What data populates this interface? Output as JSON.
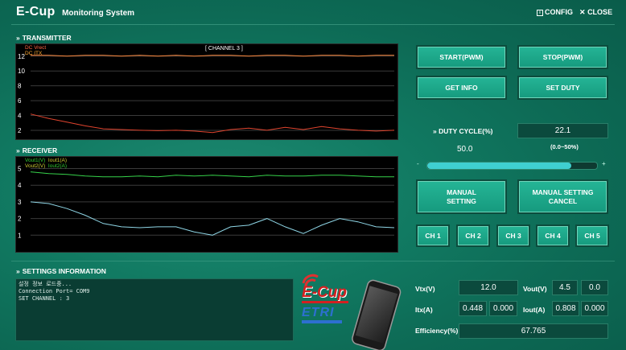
{
  "header": {
    "app_name": "E-Cup",
    "subtitle": "Monitoring System",
    "config_label": "CONFIG",
    "close_label": "CLOSE"
  },
  "transmitter": {
    "title": "TRANSMITTER",
    "channel_label": "[ CHANNEL 3 ]",
    "legend": [
      {
        "label": "DC Vrect",
        "color": "#ff6644"
      },
      {
        "label": "DC ITX",
        "color": "#ffaa33"
      }
    ],
    "y_ticks": [
      12,
      10,
      8,
      6,
      4,
      2
    ],
    "chart_data": {
      "type": "line",
      "ylim": [
        0.8,
        13.6
      ],
      "series": [
        {
          "name": "DC Vrect",
          "color": "#ff8a40",
          "values": [
            12.1,
            12.1,
            12.0,
            12.1,
            12.1,
            12.0,
            12.1,
            12.0,
            12.1,
            12.0,
            12.1,
            12.1,
            12.0,
            12.1,
            12.1,
            12.0,
            12.1,
            12.1,
            12.0,
            12.1,
            12.1
          ]
        },
        {
          "name": "DC ITX",
          "color": "#e0442e",
          "values": [
            4.2,
            3.6,
            3.1,
            2.6,
            2.2,
            2.1,
            2.0,
            1.95,
            2.0,
            1.9,
            1.7,
            2.1,
            2.3,
            2.0,
            2.4,
            2.1,
            2.5,
            2.2,
            2.0,
            1.9,
            2.0
          ]
        }
      ]
    }
  },
  "receiver": {
    "title": "RECEIVER",
    "legend": [
      {
        "label": "Vout1(V)",
        "color": "#33cc33"
      },
      {
        "label": "Iout1(A)",
        "color": "#cccc33"
      },
      {
        "label": "Vout2(V)",
        "color": "#cccc33"
      },
      {
        "label": "Iout2(A)",
        "color": "#33cc33"
      }
    ],
    "y_ticks": [
      5,
      4,
      3,
      2,
      1
    ],
    "chart_data": {
      "type": "line",
      "ylim": [
        0.0,
        5.7
      ],
      "series": [
        {
          "name": "Vout1(V)",
          "color": "#36d24a",
          "values": [
            4.8,
            4.7,
            4.65,
            4.55,
            4.5,
            4.5,
            4.55,
            4.5,
            4.6,
            4.55,
            4.6,
            4.55,
            4.5,
            4.6,
            4.55,
            4.55,
            4.6,
            4.6,
            4.55,
            4.5,
            4.5
          ]
        },
        {
          "name": "Iout1(A)",
          "color": "#8fd6e6",
          "values": [
            3.0,
            2.9,
            2.6,
            2.2,
            1.7,
            1.5,
            1.45,
            1.5,
            1.5,
            1.2,
            1.0,
            1.5,
            1.6,
            2.0,
            1.5,
            1.1,
            1.6,
            2.0,
            1.8,
            1.5,
            1.45
          ]
        }
      ]
    }
  },
  "controls": {
    "start_label": "START(PWM)",
    "stop_label": "STOP(PWM)",
    "get_info_label": "GET INFO",
    "set_duty_label": "SET DUTY",
    "duty_cycle_label": "DUTY CYCLE(%)",
    "duty_value": "22.1",
    "duty_range": "(0.0~50%)",
    "slider_value_label": "50.0",
    "slider_minus": "-",
    "slider_plus": "+",
    "slider_fraction": 0.85,
    "manual_setting_label": "MANUAL SETTING",
    "manual_cancel_label": "MANUAL SETTING CANCEL",
    "channels": [
      "CH 1",
      "CH 2",
      "CH 3",
      "CH 4",
      "CH 5"
    ]
  },
  "settings": {
    "title": "SETTINGS INFORMATION",
    "lines": [
      "설정 정보 로드중...",
      "Connection Port= COM9",
      "SET CHANNEL : 3"
    ]
  },
  "logo": {
    "ecup": "E-Cup",
    "etri": "ETRI"
  },
  "readings": {
    "vtx_label": "Vtx(V)",
    "vtx": "12.0",
    "vout_label": "Vout(V)",
    "vout1": "4.5",
    "vout2": "0.0",
    "itx_label": "Itx(A)",
    "itx1": "0.448",
    "itx2": "0.000",
    "iout_label": "Iout(A)",
    "iout1": "0.808",
    "iout2": "0.000",
    "eff_label": "Efficiency(%)",
    "eff": "67.765"
  },
  "colors": {
    "accent": "#1aa184",
    "chart_bg": "#000000"
  }
}
